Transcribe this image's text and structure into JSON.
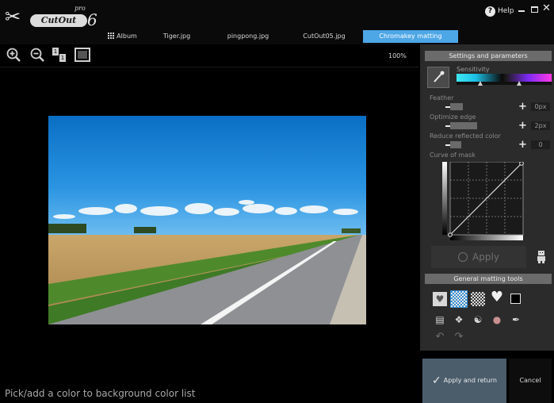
{
  "app": {
    "brand": "CutOut",
    "edition": "pro",
    "version": "6"
  },
  "tabs": [
    {
      "label": "Album",
      "icon": "album-grid-icon"
    },
    {
      "label": "Tiger.jpg"
    },
    {
      "label": "pingpong.jpg"
    },
    {
      "label": "CutOut05.jpg"
    },
    {
      "label": "Chromakey matting",
      "active": true
    }
  ],
  "window": {
    "help_label": "Help",
    "help_icon": "?"
  },
  "zoom": {
    "percent": "100%",
    "one_to_one_a": "1",
    "one_to_one_b": "1"
  },
  "status_text": "Pick/add a color to background color list",
  "panel": {
    "title": "Settings and parameters",
    "sensitivity_label": "Sensitivity",
    "sensitivity_thumbs": [
      0.25,
      0.66
    ],
    "params": [
      {
        "label": "Feather",
        "value": "0px"
      },
      {
        "label": "Optimize edge",
        "value": "2px"
      },
      {
        "label": "Reduce reflected color",
        "value": "0"
      }
    ],
    "curve_label": "Curve of mask",
    "apply_label": "Apply",
    "tools_title": "General matting tools"
  },
  "buttons": {
    "apply_return": "Apply and return",
    "cancel": "Cancel"
  },
  "colors": {
    "accent_tab": "#4da6e6",
    "panel_bg": "#2b2b2b",
    "apply_return_bg": "#4b5d6b"
  }
}
